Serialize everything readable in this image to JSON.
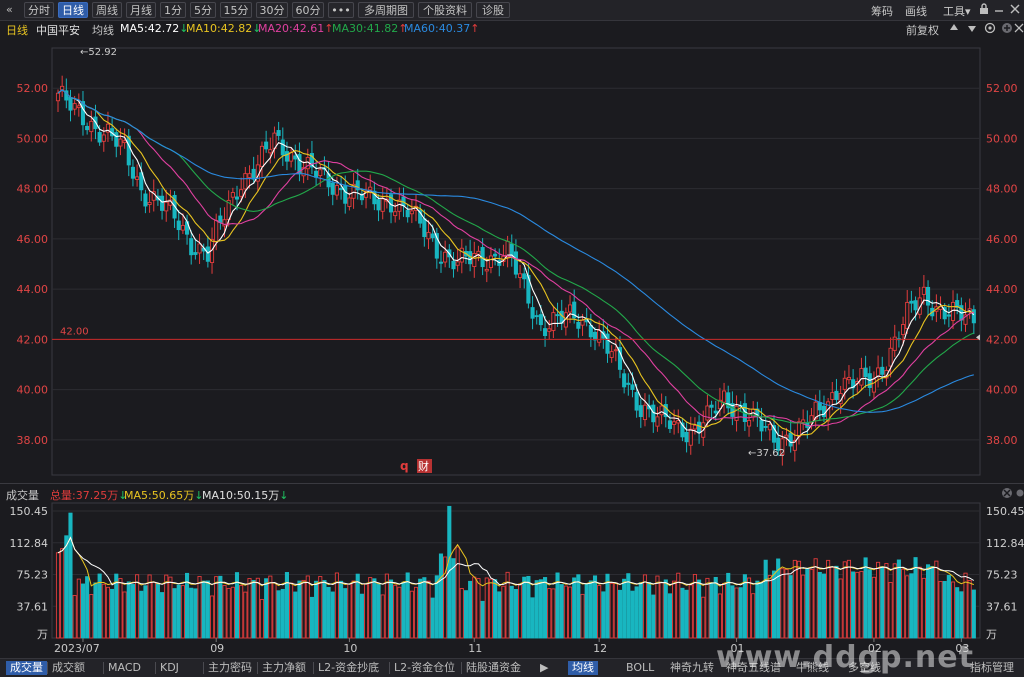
{
  "toolbar": {
    "back_icon": "«",
    "buttons": [
      "分时",
      "日线",
      "周线",
      "月线",
      "1分",
      "5分",
      "15分",
      "30分",
      "60分",
      "•••",
      "多周期图",
      "个股资料",
      "诊股"
    ],
    "active": "日线",
    "right": [
      "筹码",
      "画线",
      "工具▾"
    ],
    "window_icons": [
      "lock-icon",
      "minimize-icon",
      "close-icon"
    ]
  },
  "info_bar": {
    "period": "日线",
    "stock": "中国平安",
    "ma_label": "均线",
    "ma5": "MA5:42.72",
    "ma10": "MA10:42.82",
    "ma20": "MA20:42.61",
    "ma30": "MA30:41.82",
    "ma60": "MA60:40.37",
    "right_label": "前复权"
  },
  "colors": {
    "ma5": "#ffffff",
    "ma10": "#e8c420",
    "ma20": "#e040a0",
    "ma30": "#22a84a",
    "ma60": "#2a8ae0",
    "up": "#e23c3c",
    "down": "#18b6c0",
    "axis": "#e04545",
    "ref_line": "#c82828"
  },
  "chart_data": {
    "type": "candlestick",
    "y_ticks": [
      "52.00",
      "50.00",
      "48.00",
      "46.00",
      "44.00",
      "42.00",
      "40.00",
      "38.00"
    ],
    "ylim": [
      36.6,
      53.6
    ],
    "x_labels": [
      "2023/07",
      "09",
      "10",
      "11",
      "12",
      "01",
      "02",
      "03"
    ],
    "high_annotation": "←52.92",
    "low_annotation": "←37.62",
    "ref_line_label": "42.00",
    "markers": [
      "q",
      "财"
    ],
    "vol_y_ticks": [
      "150.45",
      "112.84",
      "75.23",
      "37.61",
      "万"
    ],
    "vol_ylim": [
      0,
      160
    ]
  },
  "volume_info": {
    "title": "成交量",
    "total": "总量:37.25万",
    "ma5": "MA5:50.65万",
    "ma10": "MA10:50.15万"
  },
  "bottom_tabs": {
    "left": [
      "成交量",
      "成交额",
      "MACD",
      "KDJ",
      "主力密码",
      "主力净额",
      "L2-资金抄底",
      "L2-资金仓位",
      "陆股通资金"
    ],
    "right": [
      "均线",
      "BOLL",
      "神奇九转",
      "神奇五线谱",
      "牛熊线",
      "多空线",
      "指标管理"
    ],
    "active": "成交量",
    "active_right": "均线"
  },
  "watermark": "www.ddgp.net"
}
